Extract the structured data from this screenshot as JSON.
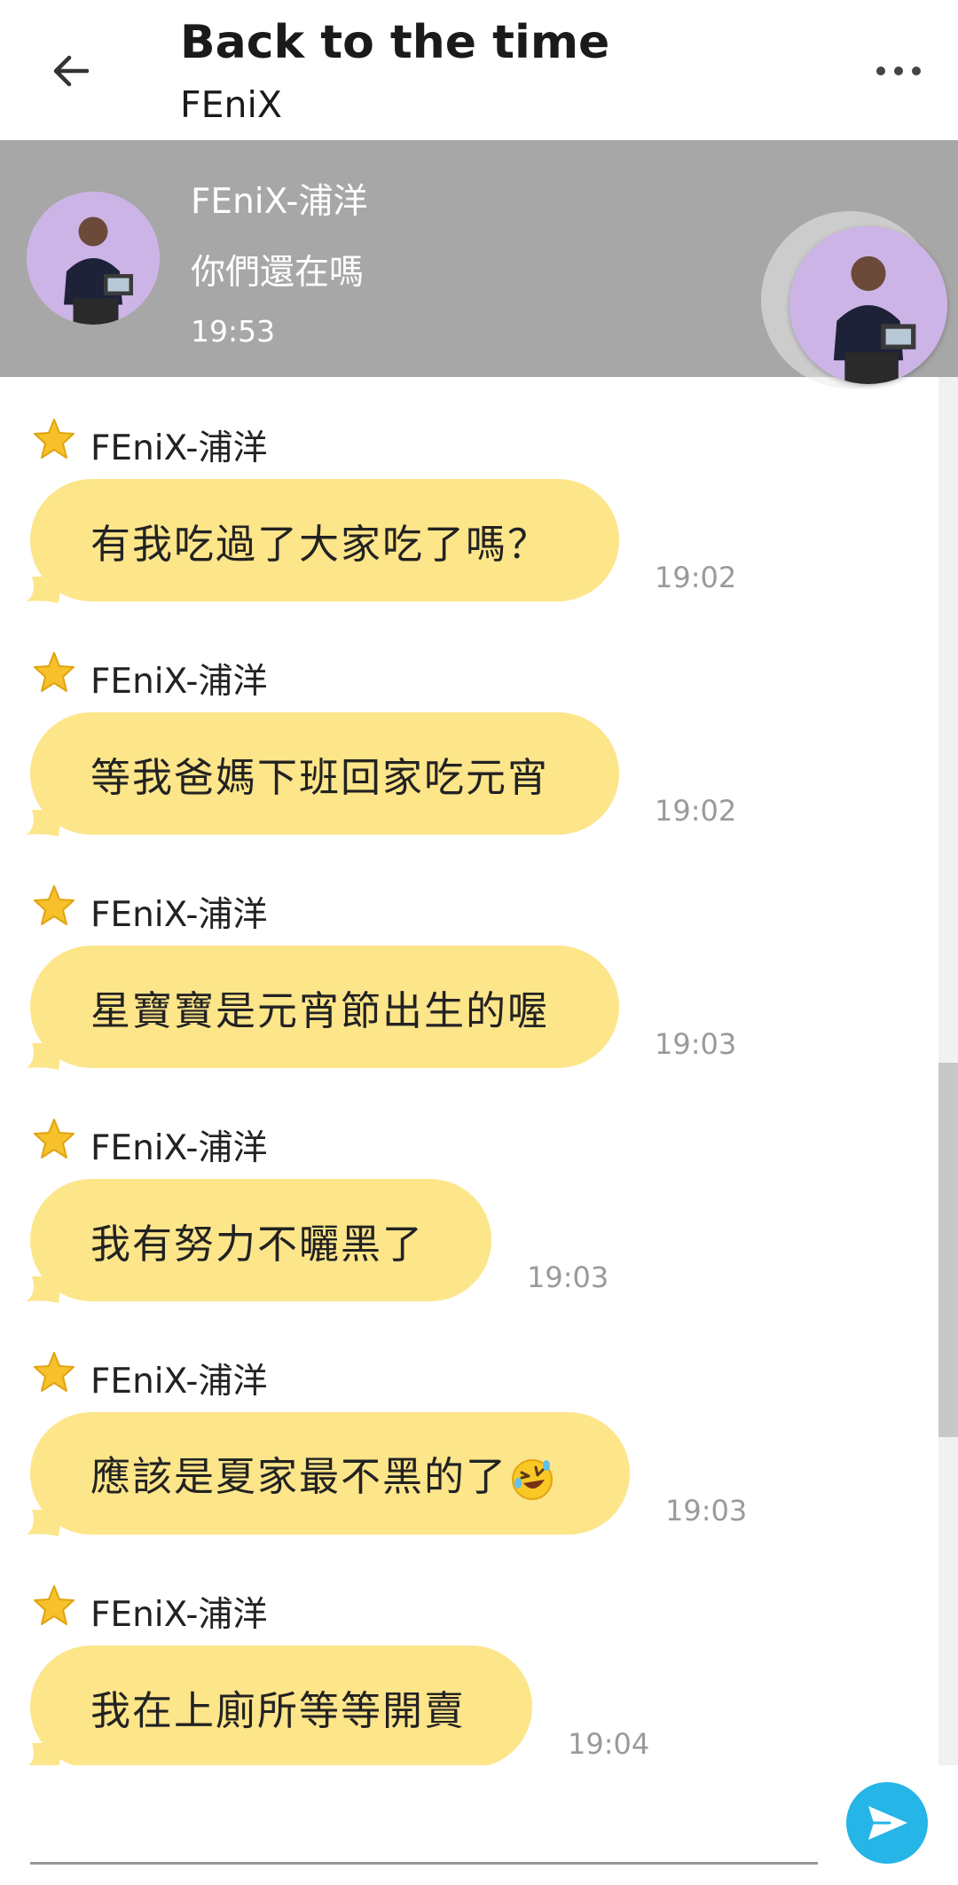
{
  "header": {
    "title": "Back to the time",
    "subtitle": "FEniX"
  },
  "pinned": {
    "sender": "FEniX-浦洋",
    "message": "你們還在嗎",
    "time": "19:53"
  },
  "messages": [
    {
      "sender": "FEniX-浦洋",
      "text": "有我吃過了大家吃了嗎？",
      "time": "19:02"
    },
    {
      "sender": "FEniX-浦洋",
      "text": "等我爸媽下班回家吃元宵",
      "time": "19:02"
    },
    {
      "sender": "FEniX-浦洋",
      "text": "星寶寶是元宵節出生的喔",
      "time": "19:03"
    },
    {
      "sender": "FEniX-浦洋",
      "text": "我有努力不曬黑了",
      "time": "19:03"
    },
    {
      "sender": "FEniX-浦洋",
      "text": "應該是夏家最不黑的了",
      "emoji": "rolling-on-floor-laughing",
      "time": "19:03"
    },
    {
      "sender": "FEniX-浦洋",
      "text": "我在上廁所等等開賣",
      "time": "19:04"
    }
  ],
  "composer": {
    "value": "",
    "placeholder": ""
  },
  "icons": {
    "back": "arrow-left-icon",
    "more": "more-options-icon",
    "star": "star-badge-icon",
    "send": "send-icon"
  },
  "colors": {
    "bubble": "#fde58a",
    "banner": "#a7a7a7",
    "send": "#25b5e6",
    "timestamp": "#9a9a9a",
    "star": "#f6c12a"
  }
}
